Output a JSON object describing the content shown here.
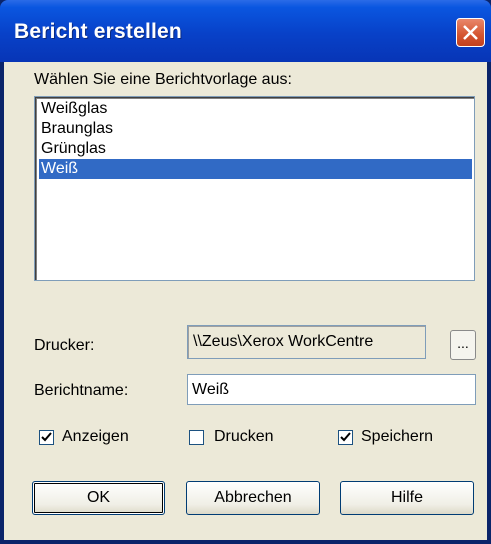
{
  "window": {
    "title": "Bericht erstellen"
  },
  "template_section": {
    "label": "Wählen Sie eine Berichtvorlage aus:",
    "items": [
      "Weißglas",
      "Braunglas",
      "Grünglas",
      "Weiß"
    ],
    "selected": "Weiß"
  },
  "printer": {
    "label": "Drucker:",
    "value": "\\\\Zeus\\Xerox WorkCentre",
    "browse_label": "..."
  },
  "report_name": {
    "label": "Berichtname:",
    "value": "Weiß"
  },
  "options": {
    "show": {
      "label": "Anzeigen",
      "checked": true
    },
    "print": {
      "label": "Drucken",
      "checked": false
    },
    "save": {
      "label": "Speichern",
      "checked": true
    }
  },
  "buttons": {
    "ok": "OK",
    "cancel": "Abbrechen",
    "help": "Hilfe"
  },
  "colors": {
    "titlebar": "#0841c8",
    "selection": "#316ac5",
    "dialog_bg": "#ece9d8",
    "close": "#d4542f"
  }
}
